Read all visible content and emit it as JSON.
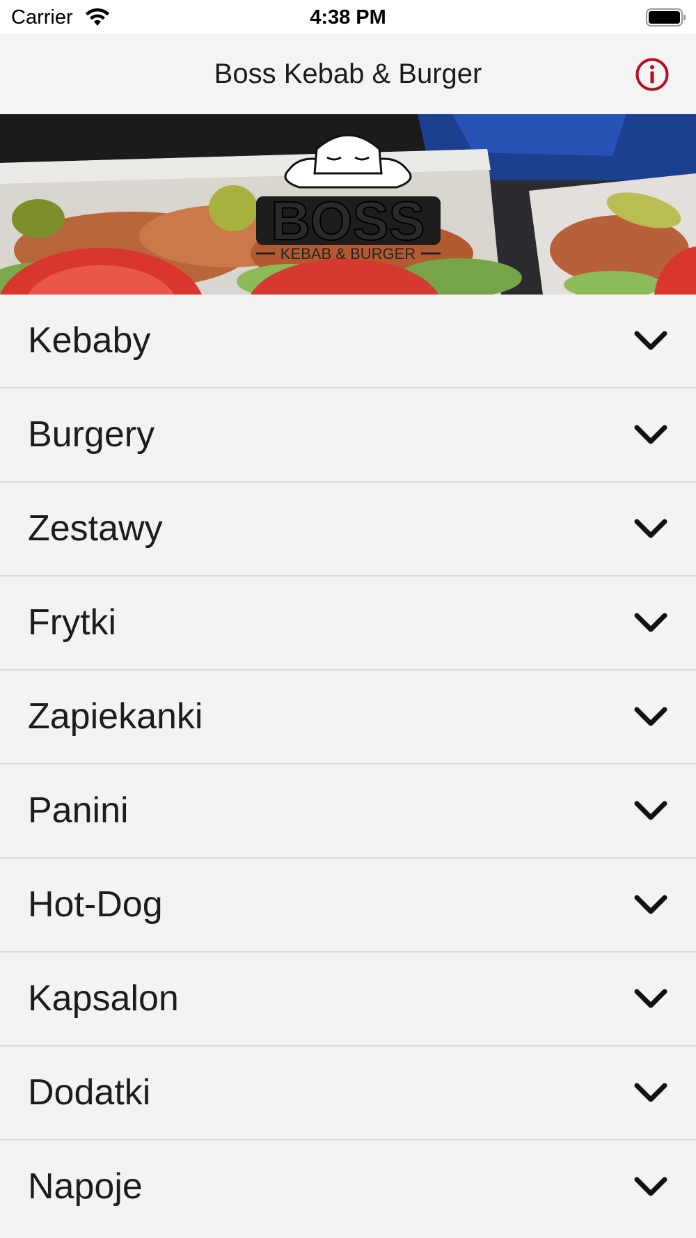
{
  "status_bar": {
    "carrier": "Carrier",
    "time": "4:38 PM",
    "wifi_icon": "wifi-icon",
    "battery_icon": "battery-icon"
  },
  "nav": {
    "title": "Boss Kebab & Burger",
    "info_icon": "info-circle-icon",
    "accent_color": "#b30f1e"
  },
  "banner": {
    "logo_text": "BOSS",
    "logo_subtext": "KEBAB & BURGER"
  },
  "menu": {
    "chevron_icon": "chevron-down-icon",
    "items": [
      {
        "label": "Kebaby"
      },
      {
        "label": "Burgery"
      },
      {
        "label": "Zestawy"
      },
      {
        "label": "Frytki"
      },
      {
        "label": "Zapiekanki"
      },
      {
        "label": "Panini"
      },
      {
        "label": "Hot-Dog"
      },
      {
        "label": "Kapsalon"
      },
      {
        "label": "Dodatki"
      },
      {
        "label": "Napoje"
      }
    ]
  }
}
